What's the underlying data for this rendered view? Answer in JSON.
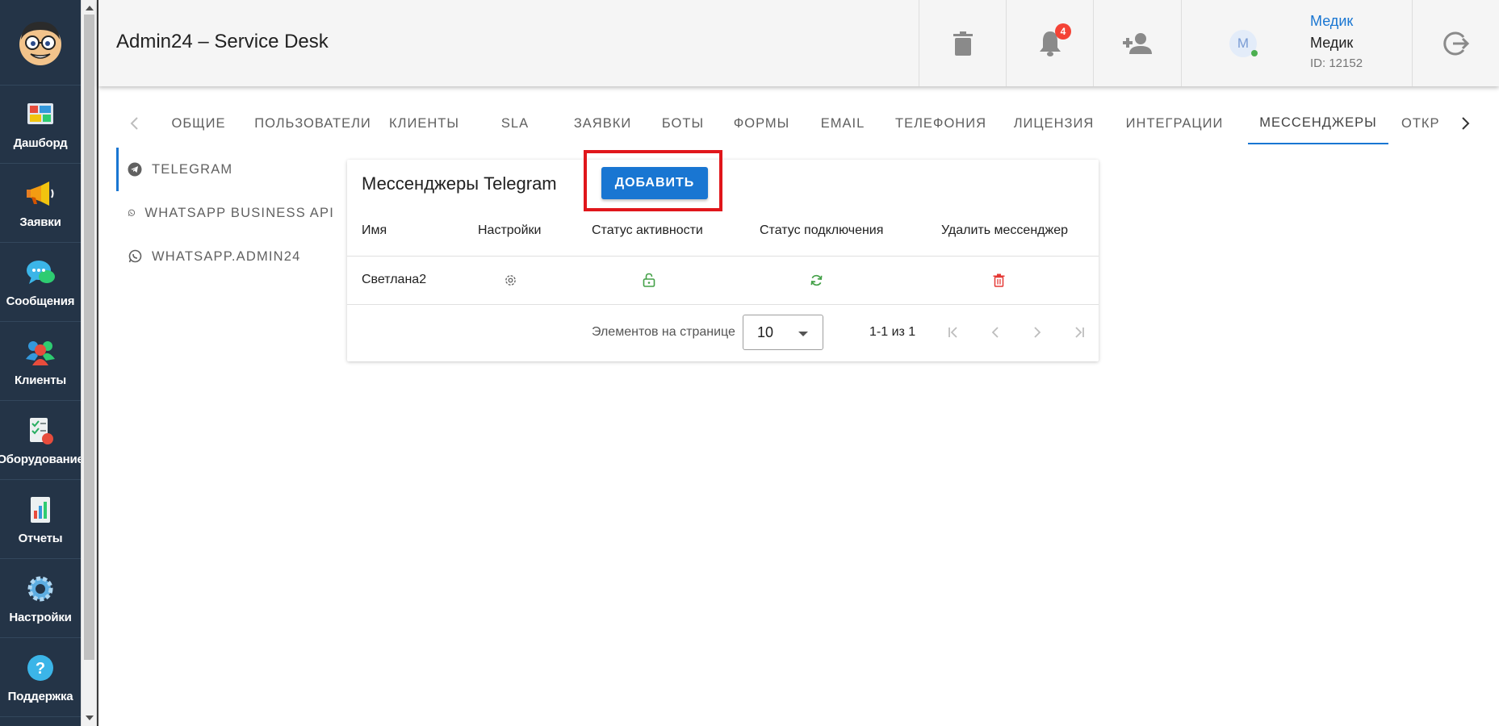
{
  "app": {
    "title": "Admin24 – Service Desk"
  },
  "sidebar": {
    "items": [
      {
        "label": "Дашборд",
        "icon": "dashboard-icon"
      },
      {
        "label": "Заявки",
        "icon": "megaphone-icon"
      },
      {
        "label": "Сообщения",
        "icon": "chat-bubble-icon"
      },
      {
        "label": "Клиенты",
        "icon": "clients-icon"
      },
      {
        "label": "Оборудование",
        "icon": "equipment-icon"
      },
      {
        "label": "Отчеты",
        "icon": "reports-icon"
      },
      {
        "label": "Настройки",
        "icon": "gear-icon"
      },
      {
        "label": "Поддержка",
        "icon": "help-icon"
      }
    ]
  },
  "header": {
    "notifications_count": "4",
    "user": {
      "initial": "М",
      "link_name": "Медик",
      "name": "Медик",
      "id": "ID: 12152"
    }
  },
  "tabs": [
    {
      "label": "ОБЩИЕ"
    },
    {
      "label": "ПОЛЬЗОВАТЕЛИ"
    },
    {
      "label": "КЛИЕНТЫ"
    },
    {
      "label": "SLA"
    },
    {
      "label": "ЗАЯВКИ"
    },
    {
      "label": "БОТЫ"
    },
    {
      "label": "ФОРМЫ"
    },
    {
      "label": "EMAIL"
    },
    {
      "label": "ТЕЛЕФОНИЯ"
    },
    {
      "label": "ЛИЦЕНЗИЯ"
    },
    {
      "label": "ИНТЕГРАЦИИ"
    },
    {
      "label": "МЕССЕНДЖЕРЫ"
    },
    {
      "label": "ОТКР"
    }
  ],
  "submenu": [
    {
      "label": "TELEGRAM",
      "icon": "telegram-icon"
    },
    {
      "label": "WHATSAPP BUSINESS API",
      "icon": "whatsapp-icon"
    },
    {
      "label": "WHATSAPP.ADMIN24",
      "icon": "whatsapp-icon"
    }
  ],
  "card": {
    "title": "Мессенджеры Telegram",
    "add_label": "ДОБАВИТЬ",
    "columns": [
      "Имя",
      "Настройки",
      "Статус активности",
      "Статус подключения",
      "Удалить мессенджер"
    ],
    "rows": [
      {
        "name": "Светлана2"
      }
    ],
    "pager": {
      "label": "Элементов на странице",
      "page_size": "10",
      "range": "1-1 из 1"
    }
  },
  "colors": {
    "accent": "#1976d2",
    "sidebar_bg": "#243447",
    "success": "#43a047",
    "danger": "#e53935",
    "highlight": "#e0161b"
  }
}
